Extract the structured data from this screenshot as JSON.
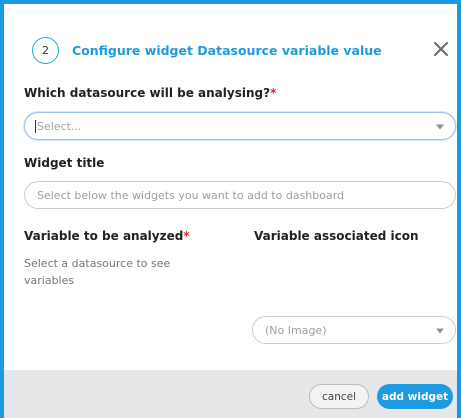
{
  "dialog": {
    "step_number": "2",
    "title": "Configure widget Datasource variable value",
    "close_icon": "close-icon"
  },
  "datasource": {
    "label": "Which datasource will be analysing?",
    "required_mark": "*",
    "placeholder": "Select..."
  },
  "widget_title": {
    "label": "Widget title",
    "placeholder": "Select below the widgets you want to add to dashboard"
  },
  "variable": {
    "label": "Variable to be analyzed",
    "required_mark": "*",
    "help_text": "Select a datasource to see variables"
  },
  "icon": {
    "label": "Variable associated icon",
    "value": "(No Image)"
  },
  "footer": {
    "cancel_label": "cancel",
    "add_label": "add widget"
  },
  "colors": {
    "accent": "#1e9be0",
    "required": "#e0262f",
    "footer_bg": "#e6e7e9"
  }
}
